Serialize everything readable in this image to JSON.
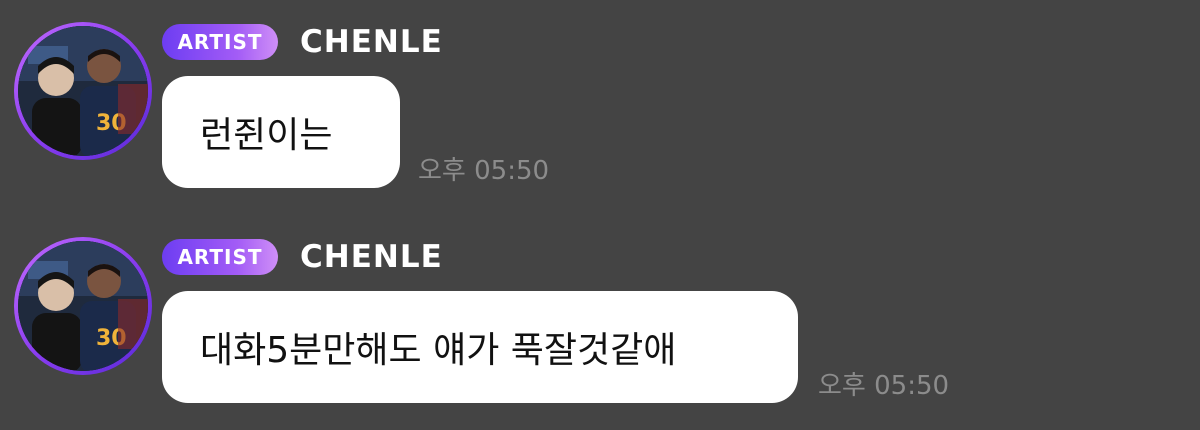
{
  "messages": [
    {
      "badge": "ARTIST",
      "sender": "CHENLE",
      "text": "런쥔이는",
      "time": "오후 05:50"
    },
    {
      "badge": "ARTIST",
      "sender": "CHENLE",
      "text": "대화5분만해도 얘가 푹잘것같애",
      "time": "오후 05:50"
    }
  ],
  "colors": {
    "background": "#444444",
    "bubble": "#ffffff",
    "badge_start": "#6d3df2",
    "badge_end": "#cf8ff7",
    "timestamp": "#8c8c8c",
    "avatar_ring": "#a35cf6"
  },
  "icons": {
    "avatar": "profile-photo"
  }
}
